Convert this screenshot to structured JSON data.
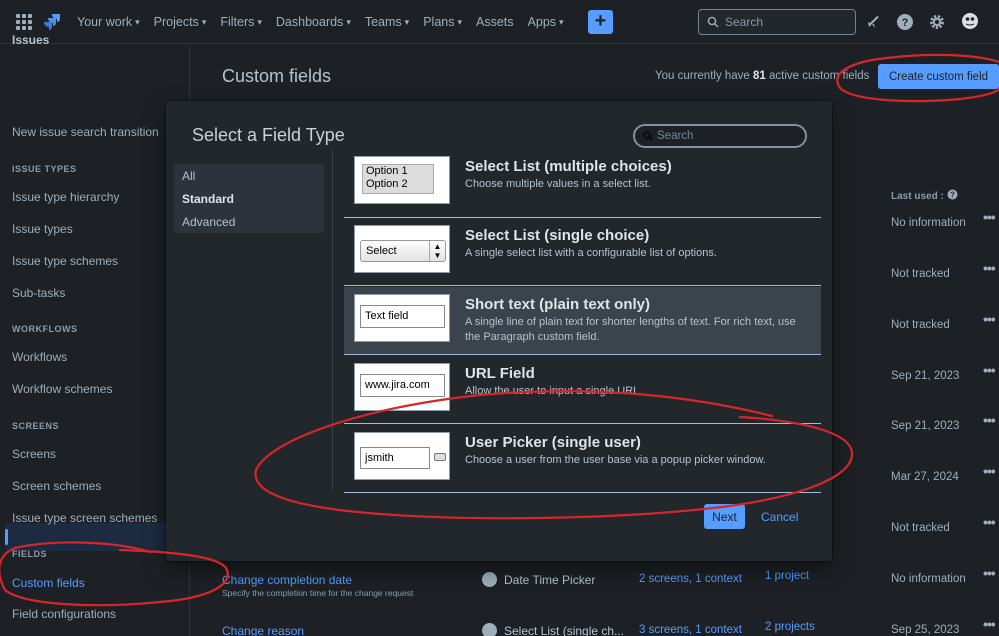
{
  "nav": {
    "items": [
      {
        "label": "Your work",
        "has_chevron": true
      },
      {
        "label": "Projects",
        "has_chevron": true
      },
      {
        "label": "Filters",
        "has_chevron": true
      },
      {
        "label": "Dashboards",
        "has_chevron": true
      },
      {
        "label": "Teams",
        "has_chevron": true
      },
      {
        "label": "Plans",
        "has_chevron": true
      },
      {
        "label": "Assets",
        "has_chevron": false
      },
      {
        "label": "Apps",
        "has_chevron": true
      }
    ],
    "create_symbol": "+",
    "search_placeholder": "Search",
    "icons": [
      "app-switcher-icon",
      "jira-logo",
      "notifications-icon",
      "help-icon",
      "settings-icon",
      "avatar"
    ]
  },
  "sidebar": {
    "title": "Issues",
    "items": [
      {
        "label": "New issue search transition"
      },
      {
        "heading": "ISSUE TYPES"
      },
      {
        "label": "Issue type hierarchy"
      },
      {
        "label": "Issue types"
      },
      {
        "label": "Issue type schemes"
      },
      {
        "label": "Sub-tasks"
      },
      {
        "heading": "WORKFLOWS"
      },
      {
        "label": "Workflows"
      },
      {
        "label": "Workflow schemes"
      },
      {
        "heading": "SCREENS"
      },
      {
        "label": "Screens"
      },
      {
        "label": "Screen schemes"
      },
      {
        "label": "Issue type screen schemes"
      },
      {
        "heading": "FIELDS"
      },
      {
        "label": "Custom fields",
        "active": true
      },
      {
        "label": "Field configurations"
      }
    ]
  },
  "page": {
    "title": "Custom fields",
    "active_prefix": "You currently have ",
    "active_count": "81",
    "active_suffix": " active custom fields",
    "create_button": "Create custom field",
    "last_used_header": "Last used :",
    "last_used_values": [
      "No information",
      "Not tracked",
      "Not tracked",
      "Sep 21, 2023",
      "Sep 21, 2023",
      "Mar 27, 2024",
      "Not tracked",
      "No information",
      "Sep 25, 2023"
    ],
    "rows": [
      {
        "name": "Change completion date",
        "desc": "Specify the completion time for the change request",
        "type": "Date Time Picker",
        "screens": "2 screens, 1 context",
        "projects": "1 project"
      },
      {
        "name": "Change reason",
        "desc": "",
        "type": "Select List (single ch...",
        "screens": "3 screens, 1 context",
        "projects": "2 projects"
      }
    ]
  },
  "modal": {
    "title": "Select a Field Type",
    "search_placeholder": "Search",
    "categories": [
      {
        "label": "All",
        "bold": false
      },
      {
        "label": "Standard",
        "bold": true
      },
      {
        "label": "Advanced",
        "bold": false
      }
    ],
    "field_types": [
      {
        "name": "Select List (multiple choices)",
        "desc": "Choose multiple values in a select list.",
        "preview": [
          "Option 1",
          "Option 2"
        ]
      },
      {
        "name": "Select List (single choice)",
        "desc": "A single select list with a configurable list of options.",
        "preview": "Select"
      },
      {
        "name": "Short text (plain text only)",
        "desc": "A single line of plain text for shorter lengths of text. For rich text, use the Paragraph custom field.",
        "preview": "Text field",
        "selected": true
      },
      {
        "name": "URL Field",
        "desc": "Allow the user to input a single URL",
        "preview": "www.jira.com"
      },
      {
        "name": "User Picker (single user)",
        "desc": "Choose a user from the user base via a popup picker window.",
        "preview": "jsmith"
      }
    ],
    "next_button": "Next",
    "cancel_button": "Cancel"
  },
  "colors": {
    "background": "#1d2125",
    "accent": "#579dff",
    "annotation": "#d7262b"
  }
}
